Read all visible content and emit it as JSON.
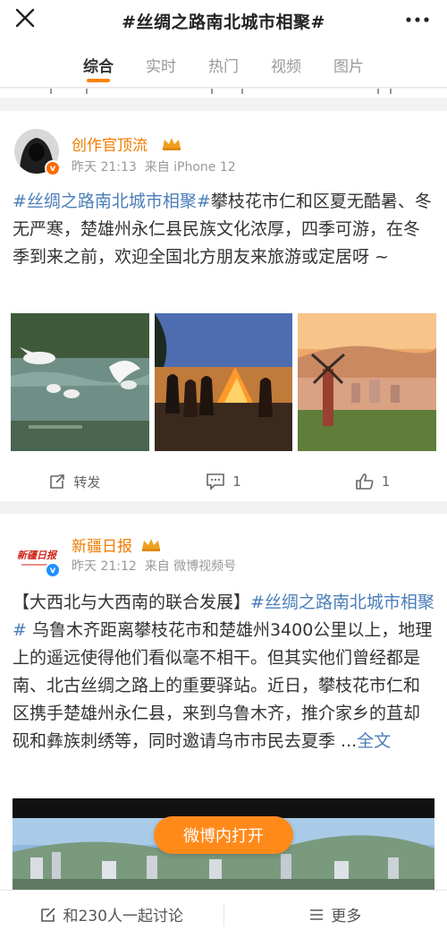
{
  "header": {
    "title": "#丝绸之路南北城市相聚#"
  },
  "tabs": [
    {
      "label": "综合",
      "active": true
    },
    {
      "label": "实时",
      "active": false
    },
    {
      "label": "热门",
      "active": false
    },
    {
      "label": "视频",
      "active": false
    },
    {
      "label": "图片",
      "active": false
    }
  ],
  "colors": {
    "accent": "#ff8200",
    "link": "#4a7eb8",
    "username": "#f07c00",
    "open_button": "#ff8a1a"
  },
  "posts": [
    {
      "username": "创作官顶流",
      "time": "昨天 21:13",
      "source": "来自 iPhone 12",
      "hashtag": "#丝绸之路南北城市相聚#",
      "text": "攀枝花市仁和区夏无酷暑、冬无严寒，楚雄州永仁县民族文化浓厚，四季可游，在冬季到来之前，欢迎全国北方朋友来旅游或定居呀 ~",
      "images": [
        "egrets-in-water",
        "bonfire-dancers",
        "windmill-city-sunset"
      ],
      "actions": {
        "repost": "转发",
        "comments": "1",
        "likes": "1"
      }
    },
    {
      "username": "新疆日报",
      "logo_text": "新疆日报",
      "time": "昨天 21:12",
      "source": "来自 微博视频号",
      "prefix": "【大西北与大西南的联合发展】",
      "hashtag": "#丝绸之路南北城市相聚#",
      "text": " 乌鲁木齐距离攀枝花市和楚雄州3400公里以上，地理上的遥远使得他们看似毫不相干。但其实他们曾经都是南、北古丝绸之路上的重要驿站。近日，攀枝花市仁和区携手楚雄州永仁县，来到乌鲁木齐，推介家乡的苴却砚和彝族刺绣等，同时邀请乌市市民去夏季 ...",
      "full_link": "全文",
      "video_button": "微博内打开"
    }
  ],
  "bottom_bar": {
    "discuss": "和230人一起讨论",
    "more": "更多"
  }
}
